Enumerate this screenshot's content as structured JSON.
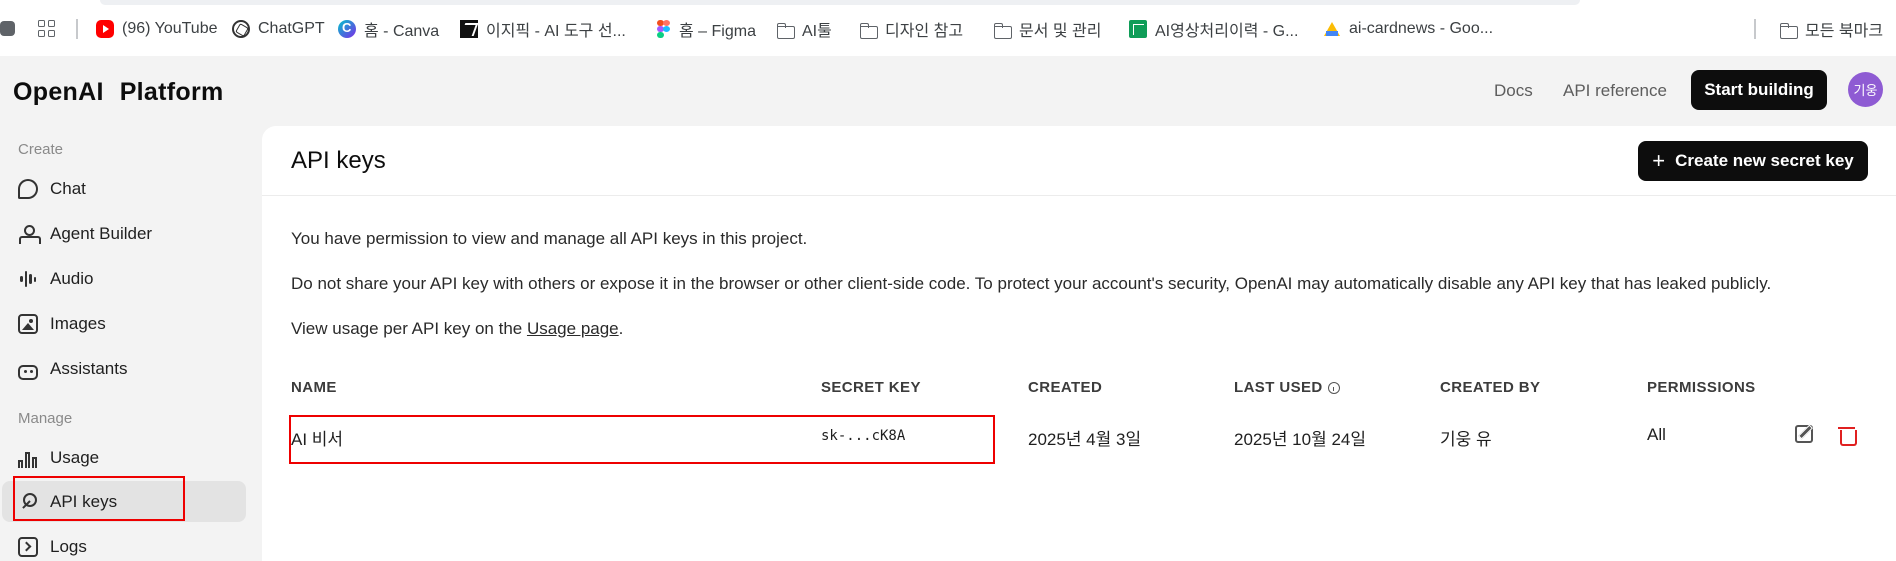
{
  "bookmarks": {
    "items": [
      {
        "label": "(96) YouTube",
        "icon": "youtube-icon"
      },
      {
        "label": "ChatGPT",
        "icon": "chatgpt-icon"
      },
      {
        "label": "홈 - Canva",
        "icon": "canva-icon"
      },
      {
        "label": "이지픽 - AI 도구 선...",
        "icon": "ejpick-icon"
      },
      {
        "label": "홈 – Figma",
        "icon": "figma-icon"
      },
      {
        "label": "AI툴",
        "icon": "folder-icon"
      },
      {
        "label": "디자인 참고",
        "icon": "folder-icon"
      },
      {
        "label": "문서 및 관리",
        "icon": "folder-icon"
      },
      {
        "label": "AI영상처리이력 - G...",
        "icon": "sheets-icon"
      },
      {
        "label": "ai-cardnews - Goo...",
        "icon": "drive-icon"
      }
    ],
    "all_bookmarks": "모든 북마크"
  },
  "header": {
    "logo_openai": "OpenAI",
    "logo_platform": "Platform",
    "docs": "Docs",
    "api_reference": "API reference",
    "start_building": "Start building",
    "avatar": "기웅"
  },
  "sidebar": {
    "create_label": "Create",
    "manage_label": "Manage",
    "create_items": [
      {
        "label": "Chat",
        "icon": "chat-icon"
      },
      {
        "label": "Agent Builder",
        "icon": "agent-builder-icon"
      },
      {
        "label": "Audio",
        "icon": "audio-icon"
      },
      {
        "label": "Images",
        "icon": "images-icon"
      },
      {
        "label": "Assistants",
        "icon": "assistants-icon"
      }
    ],
    "manage_items": [
      {
        "label": "Usage",
        "icon": "usage-icon"
      },
      {
        "label": "API keys",
        "icon": "key-icon",
        "active": true
      },
      {
        "label": "Logs",
        "icon": "logs-icon"
      }
    ]
  },
  "main": {
    "title": "API keys",
    "create_button": "Create new secret key",
    "desc1": "You have permission to view and manage all API keys in this project.",
    "desc2": "Do not share your API key with others or expose it in the browser or other client-side code. To protect your account's security, OpenAI may automatically disable any API key that has leaked publicly.",
    "desc3_prefix": "View usage per API key on the ",
    "desc3_link": "Usage page",
    "desc3_suffix": ".",
    "table": {
      "headers": {
        "name": "NAME",
        "secret_key": "SECRET KEY",
        "created": "CREATED",
        "last_used": "LAST USED",
        "created_by": "CREATED BY",
        "permissions": "PERMISSIONS"
      },
      "rows": [
        {
          "name": "AI 비서",
          "secret_key": "sk-...cK8A",
          "created": "2025년 4월 3일",
          "last_used": "2025년 10월 24일",
          "created_by": "기웅 유",
          "permissions": "All"
        }
      ]
    }
  },
  "colors": {
    "highlight_box": "#ee0000",
    "primary_button": "#0d0d0d",
    "avatar": "#8e5bd3",
    "delete": "#e02020"
  }
}
